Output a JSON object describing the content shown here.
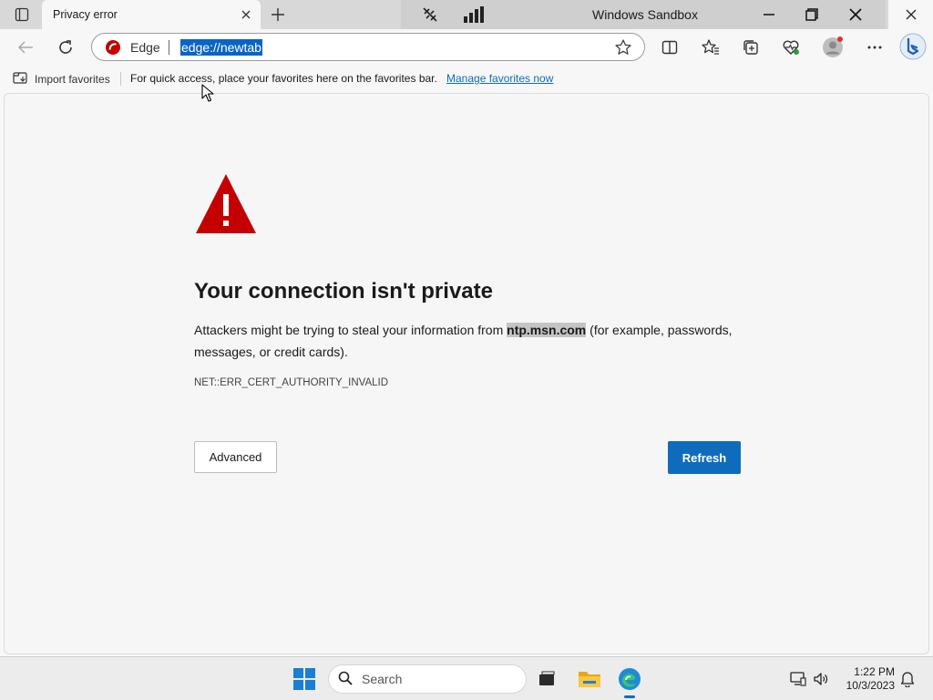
{
  "browser": {
    "tab_title": "Privacy error",
    "tab_close_icon": "close-icon",
    "new_tab_icon": "plus-icon",
    "tab_actions_icon": "tab-actions-icon"
  },
  "sandbox": {
    "title": "Windows Sandbox",
    "icons": [
      "network-icon",
      "signal-bars-icon"
    ]
  },
  "window_controls": {
    "minimize_icon": "minimize-icon",
    "restore_icon": "restore-icon",
    "close_icon": "close-icon"
  },
  "toolbar": {
    "back_icon": "back-arrow-icon",
    "refresh_icon": "refresh-icon",
    "address": {
      "site_label": "Edge",
      "url": "edge://newtab"
    },
    "tools": [
      "favorite-star-icon",
      "split-screen-icon",
      "favorites-icon",
      "collections-icon",
      "performance-icon",
      "profile-icon",
      "more-icon",
      "copilot-icon"
    ]
  },
  "favorites_bar": {
    "import_label": "Import favorites",
    "message": "For quick access, place your favorites here on the favorites bar.",
    "manage_link": "Manage favorites now"
  },
  "error_page": {
    "heading": "Your connection isn't private",
    "message_before": "Attackers might be trying to steal your information from ",
    "host": "ntp.msn.com",
    "message_after": " (for example, passwords, messages, or credit cards).",
    "error_code": "NET::ERR_CERT_AUTHORITY_INVALID",
    "advanced_label": "Advanced",
    "refresh_label": "Refresh",
    "colors": {
      "warning": "#c40000",
      "primary_button": "#0f6cbd"
    }
  },
  "taskbar": {
    "search_placeholder": "Search",
    "apps": [
      "windows-start-icon",
      "task-view-icon",
      "file-explorer-icon",
      "edge-icon"
    ],
    "tray": [
      "display-icon",
      "speaker-icon",
      "notification-bell-icon"
    ],
    "time": "1:22 PM",
    "date": "10/3/2023"
  }
}
